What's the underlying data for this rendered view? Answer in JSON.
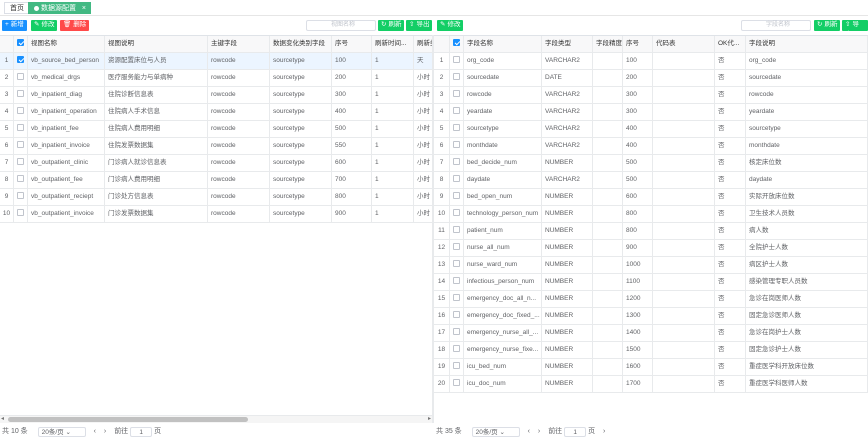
{
  "tabs": {
    "home": "首页",
    "active": "数据源配置",
    "close": "×"
  },
  "left": {
    "toolbar": {
      "add": "新增",
      "edit": "修改",
      "delete": "删除",
      "search_placeholder": "视图名称",
      "refresh": "刷新",
      "export": "导出"
    },
    "columns": [
      "视图名称",
      "视图说明",
      "主键字段",
      "数据变化类别字段",
      "序号",
      "刷新时间...",
      "刷新类"
    ],
    "rows": [
      [
        "vb_source_bed_person",
        "资源配置床位与人员",
        "rowcode",
        "sourcetype",
        "100",
        "1",
        "天"
      ],
      [
        "vb_medical_drgs",
        "医疗服务能力与单病种",
        "rowcode",
        "sourcetype",
        "200",
        "1",
        "小时"
      ],
      [
        "vb_inpatient_diag",
        "住院诊断信息表",
        "rowcode",
        "sourcetype",
        "300",
        "1",
        "小时"
      ],
      [
        "vb_inpatient_operation",
        "住院病人手术信息",
        "rowcode",
        "sourcetype",
        "400",
        "1",
        "小时"
      ],
      [
        "vb_inpatient_fee",
        "住院病人费用明细",
        "rowcode",
        "sourcetype",
        "500",
        "1",
        "小时"
      ],
      [
        "vb_inpatient_invoice",
        "住院发票数据集",
        "rowcode",
        "sourcetype",
        "550",
        "1",
        "小时"
      ],
      [
        "vb_outpatient_clinic",
        "门诊病人就诊信息表",
        "rowcode",
        "sourcetype",
        "600",
        "1",
        "小时"
      ],
      [
        "vb_outpatient_fee",
        "门诊病人费用明细",
        "rowcode",
        "sourcetype",
        "700",
        "1",
        "小时"
      ],
      [
        "vb_outpatient_reciept",
        "门诊处方信息表",
        "rowcode",
        "sourcetype",
        "800",
        "1",
        "小时"
      ],
      [
        "vb_outpatient_invoice",
        "门诊发票数据集",
        "rowcode",
        "sourcetype",
        "900",
        "1",
        "小时"
      ]
    ],
    "selected_row": 1,
    "pager": {
      "total": "共 10 条",
      "page_size": "20条/页",
      "goto": "前往",
      "page": "1",
      "page_unit": "页"
    }
  },
  "right": {
    "toolbar": {
      "edit": "修改",
      "search_placeholder": "字段名称",
      "refresh": "刷新",
      "export": "导出"
    },
    "columns": [
      "字段名称",
      "字段类型",
      "字段精度",
      "序号",
      "代码表",
      "OK代...",
      "字段说明"
    ],
    "rows": [
      [
        "org_code",
        "VARCHAR2",
        "",
        "100",
        "",
        "否",
        "org_code"
      ],
      [
        "sourcedate",
        "DATE",
        "",
        "200",
        "",
        "否",
        "sourcedate"
      ],
      [
        "rowcode",
        "VARCHAR2",
        "",
        "300",
        "",
        "否",
        "rowcode"
      ],
      [
        "yeardate",
        "VARCHAR2",
        "",
        "300",
        "",
        "否",
        "yeardate"
      ],
      [
        "sourcetype",
        "VARCHAR2",
        "",
        "400",
        "",
        "否",
        "sourcetype"
      ],
      [
        "monthdate",
        "VARCHAR2",
        "",
        "400",
        "",
        "否",
        "monthdate"
      ],
      [
        "bed_decide_num",
        "NUMBER",
        "",
        "500",
        "",
        "否",
        "核定床位数"
      ],
      [
        "daydate",
        "VARCHAR2",
        "",
        "500",
        "",
        "否",
        "daydate"
      ],
      [
        "bed_open_num",
        "NUMBER",
        "",
        "600",
        "",
        "否",
        "实际开放床位数"
      ],
      [
        "technology_person_num",
        "NUMBER",
        "",
        "800",
        "",
        "否",
        "卫生技术人员数"
      ],
      [
        "patient_num",
        "NUMBER",
        "",
        "800",
        "",
        "否",
        "病人数"
      ],
      [
        "nurse_all_num",
        "NUMBER",
        "",
        "900",
        "",
        "否",
        "全院护士人数"
      ],
      [
        "nurse_ward_num",
        "NUMBER",
        "",
        "1000",
        "",
        "否",
        "病区护士人数"
      ],
      [
        "infectious_person_num",
        "NUMBER",
        "",
        "1100",
        "",
        "否",
        "感染管理专职人员数"
      ],
      [
        "emergency_doc_all_n...",
        "NUMBER",
        "",
        "1200",
        "",
        "否",
        "急诊在岗医师人数"
      ],
      [
        "emergency_doc_fixed_...",
        "NUMBER",
        "",
        "1300",
        "",
        "否",
        "固定急诊医师人数"
      ],
      [
        "emergency_nurse_all_...",
        "NUMBER",
        "",
        "1400",
        "",
        "否",
        "急诊在岗护士人数"
      ],
      [
        "emergency_nurse_fixe...",
        "NUMBER",
        "",
        "1500",
        "",
        "否",
        "固定急诊护士人数"
      ],
      [
        "icu_bed_num",
        "NUMBER",
        "",
        "1600",
        "",
        "否",
        "重症医学科开放床位数"
      ],
      [
        "icu_doc_num",
        "NUMBER",
        "",
        "1700",
        "",
        "否",
        "重症医学科医师人数"
      ]
    ],
    "pager": {
      "total": "共 35 条",
      "page_size": "20条/页",
      "goto": "前往",
      "page": "1",
      "page_unit": "页"
    }
  }
}
